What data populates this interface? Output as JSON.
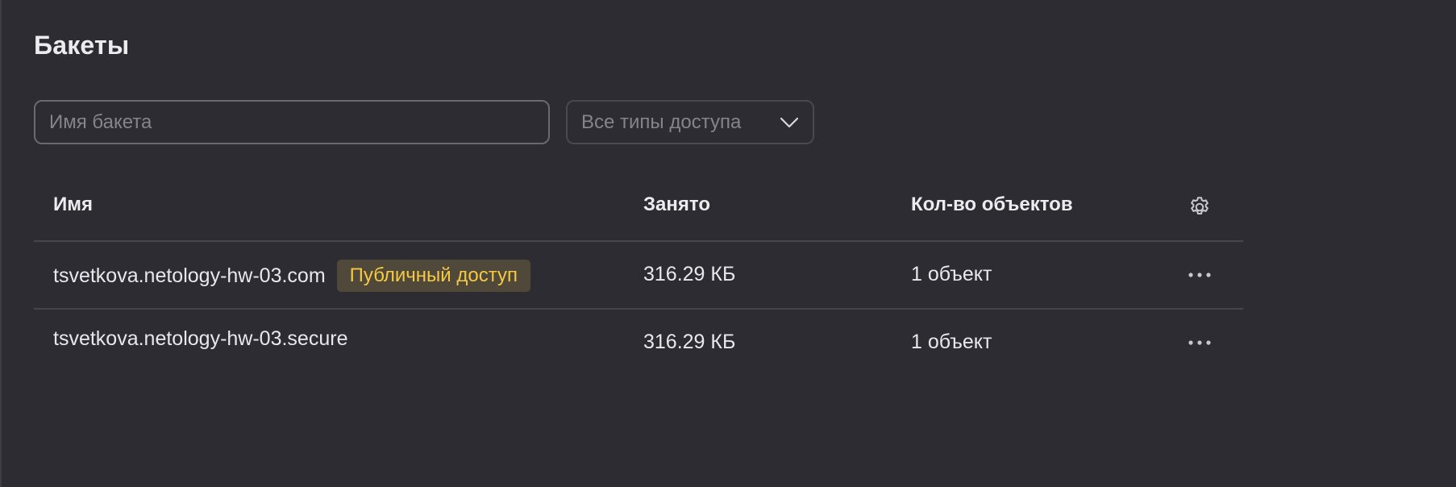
{
  "page": {
    "title": "Бакеты"
  },
  "filters": {
    "search_placeholder": "Имя бакета",
    "search_value": "",
    "access_type_selected": "Все типы доступа"
  },
  "table": {
    "headers": {
      "name": "Имя",
      "size": "Занято",
      "count": "Кол-во объектов"
    },
    "rows": [
      {
        "name": "tsvetkova.netology-hw-03.com",
        "badge": "Публичный доступ",
        "size": "316.29 КБ",
        "count": "1 объект"
      },
      {
        "name": "tsvetkova.netology-hw-03.secure",
        "badge": "",
        "size": "316.29 КБ",
        "count": "1 объект"
      }
    ]
  },
  "icons": {
    "settings": "gear-icon",
    "row_actions": "more-horizontal-icon",
    "select_arrow": "chevron-down-icon"
  },
  "colors": {
    "background": "#2d2c33",
    "badge_background": "#504838",
    "badge_text": "#f5c945",
    "divider": "#46454d"
  }
}
